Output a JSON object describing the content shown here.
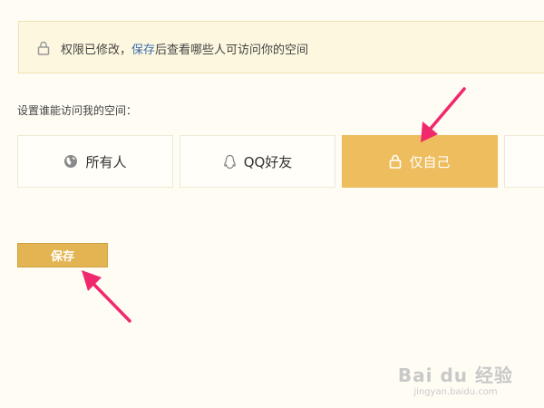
{
  "notice": {
    "prefix": "权限已修改，",
    "link": "保存",
    "suffix": "后查看哪些人可访问你的空间",
    "icon": "lock-icon"
  },
  "section_label": "设置谁能访问我的空间：",
  "options": [
    {
      "label": "所有人",
      "icon": "globe-icon",
      "selected": false
    },
    {
      "label": "QQ好友",
      "icon": "qq-penguin-icon",
      "selected": false
    },
    {
      "label": "仅自己",
      "icon": "lock-icon",
      "selected": true
    },
    {
      "label": "",
      "icon": "",
      "selected": false
    }
  ],
  "save_button": {
    "label": "保存"
  },
  "colors": {
    "selected_bg": "#edbd5e",
    "button_bg": "#e3b552",
    "arrow": "#f0286c",
    "page_bg": "#fffcf3"
  },
  "watermark": {
    "main": "Bai du 经验",
    "sub": "jingyan.baidu.com"
  }
}
